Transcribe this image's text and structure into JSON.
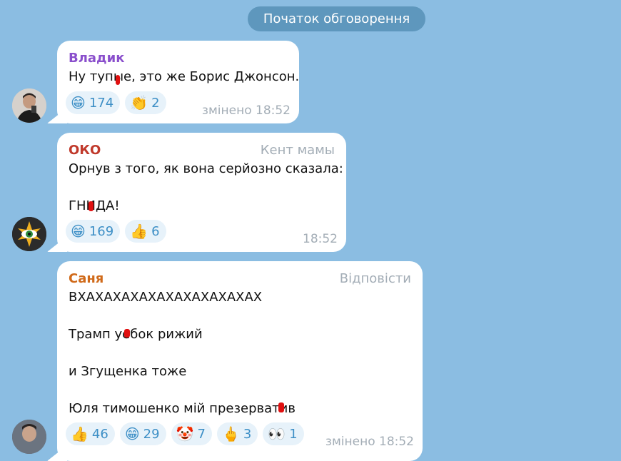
{
  "header": {
    "discussion_start": "Початок обговорення"
  },
  "messages": [
    {
      "sender": "Владик",
      "sender_color": "#8a4fcc",
      "text": "Ну тупые, это же Борис Джонсон.",
      "reactions": [
        {
          "emoji": "grinning-face",
          "glyph": "😁",
          "count": "174"
        },
        {
          "emoji": "clapping-hands",
          "glyph": "👏",
          "count": "2"
        }
      ],
      "time": "змінено 18:52"
    },
    {
      "sender": "ОКО",
      "sender_color": "#c0392b",
      "right_label": "Кент мамы",
      "text_lines": [
        "Орнув з того, як вона серйозно сказала:",
        "",
        "ГНИДА!"
      ],
      "reactions": [
        {
          "emoji": "grinning-face",
          "glyph": "😁",
          "count": "169"
        },
        {
          "emoji": "thumbs-up",
          "glyph": "👍",
          "count": "6"
        }
      ],
      "time": "18:52"
    },
    {
      "sender": "Саня",
      "sender_color": "#d06a1a",
      "right_label": "Відповісти",
      "text_lines": [
        "ВХАХАХАХАХАХАХАХАХАХАХ",
        "",
        "Трамп уебок рижий",
        "",
        "и Згущенка тоже",
        "",
        "Юля тимошенко мій презерватив"
      ],
      "reactions": [
        {
          "emoji": "thumbs-up",
          "glyph": "👍",
          "count": "46"
        },
        {
          "emoji": "grinning-face",
          "glyph": "😁",
          "count": "29"
        },
        {
          "emoji": "clown-face",
          "glyph": "🤡",
          "count": "7"
        },
        {
          "emoji": "middle-finger",
          "glyph": "🖕",
          "count": "3"
        },
        {
          "emoji": "eyes",
          "glyph": "👀",
          "count": "1"
        }
      ],
      "time": "змінено 18:52"
    }
  ]
}
